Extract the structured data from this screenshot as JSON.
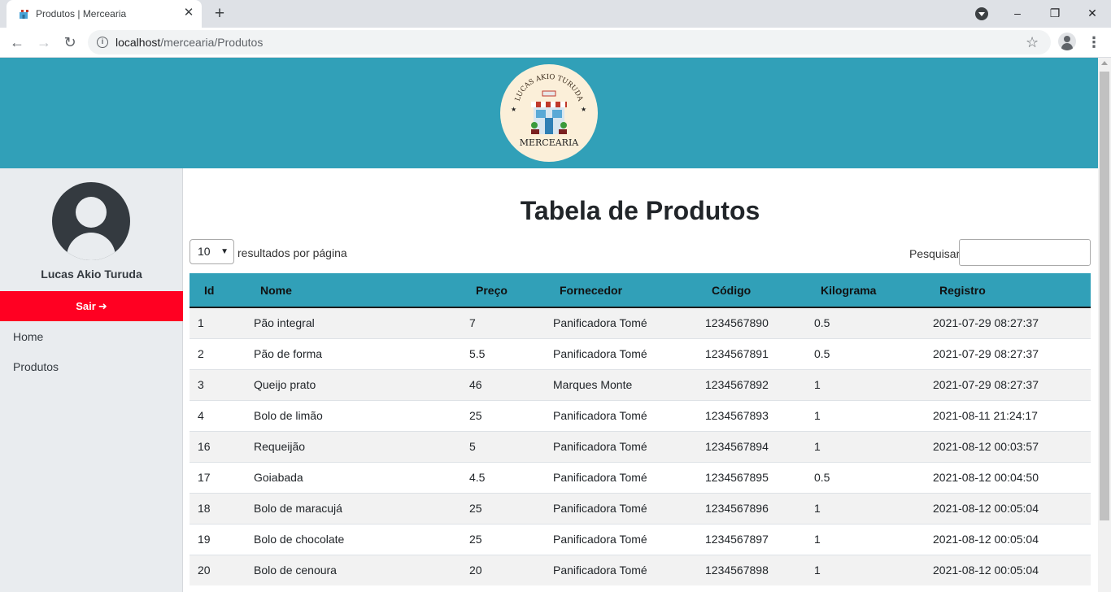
{
  "browser": {
    "tab_title": "Produtos | Mercearia",
    "url_host": "localhost",
    "url_path": "/mercearia/Produtos"
  },
  "header": {
    "logo_arc_text": "LUCAS AKIO TURUDA",
    "logo_bottom_text": "MERCEARIA"
  },
  "sidebar": {
    "user_name": "Lucas Akio Turuda",
    "logout_label": "Sair",
    "links": [
      "Home",
      "Produtos"
    ]
  },
  "main": {
    "title": "Tabela de Produtos",
    "page_length_value": "10",
    "page_length_label": "resultados por página",
    "search_label": "Pesquisar",
    "search_value": ""
  },
  "table": {
    "columns": [
      "Id",
      "Nome",
      "Preço",
      "Fornecedor",
      "Código",
      "Kilograma",
      "Registro"
    ],
    "rows": [
      [
        "1",
        "Pão integral",
        "7",
        "Panificadora Tomé",
        "1234567890",
        "0.5",
        "2021-07-29 08:27:37"
      ],
      [
        "2",
        "Pão de forma",
        "5.5",
        "Panificadora Tomé",
        "1234567891",
        "0.5",
        "2021-07-29 08:27:37"
      ],
      [
        "3",
        "Queijo prato",
        "46",
        "Marques Monte",
        "1234567892",
        "1",
        "2021-07-29 08:27:37"
      ],
      [
        "4",
        "Bolo de limão",
        "25",
        "Panificadora Tomé",
        "1234567893",
        "1",
        "2021-08-11 21:24:17"
      ],
      [
        "16",
        "Requeijão",
        "5",
        "Panificadora Tomé",
        "1234567894",
        "1",
        "2021-08-12 00:03:57"
      ],
      [
        "17",
        "Goiabada",
        "4.5",
        "Panificadora Tomé",
        "1234567895",
        "0.5",
        "2021-08-12 00:04:50"
      ],
      [
        "18",
        "Bolo de maracujá",
        "25",
        "Panificadora Tomé",
        "1234567896",
        "1",
        "2021-08-12 00:05:04"
      ],
      [
        "19",
        "Bolo de chocolate",
        "25",
        "Panificadora Tomé",
        "1234567897",
        "1",
        "2021-08-12 00:05:04"
      ],
      [
        "20",
        "Bolo de cenoura",
        "20",
        "Panificadora Tomé",
        "1234567898",
        "1",
        "2021-08-12 00:05:04"
      ]
    ]
  },
  "colors": {
    "header_bg": "#31a0b8",
    "sidebar_bg": "#e9ecef",
    "logout_bg": "#ff0022",
    "row_striped": "#f2f2f2"
  }
}
